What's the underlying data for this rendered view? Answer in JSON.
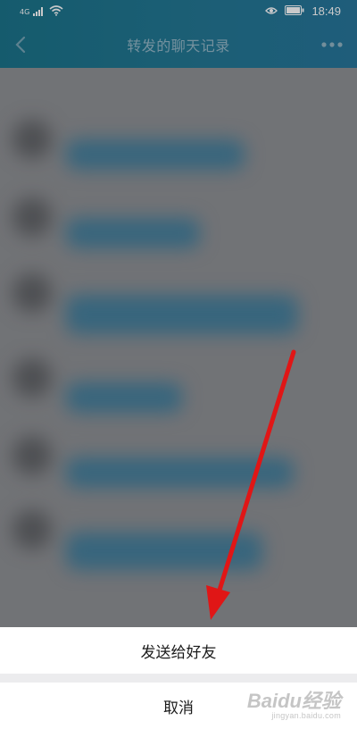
{
  "status_bar": {
    "network": "4G",
    "time": "18:49"
  },
  "nav": {
    "title": "转发的聊天记录"
  },
  "sheet": {
    "forward_label": "发送给好友",
    "cancel_label": "取消"
  },
  "watermark": {
    "logo": "Baidu经验",
    "sub": "jingyan.baidu.com"
  },
  "colors": {
    "header": "#17708d",
    "bubble": "#3d7a98",
    "arrow": "#e01616"
  }
}
